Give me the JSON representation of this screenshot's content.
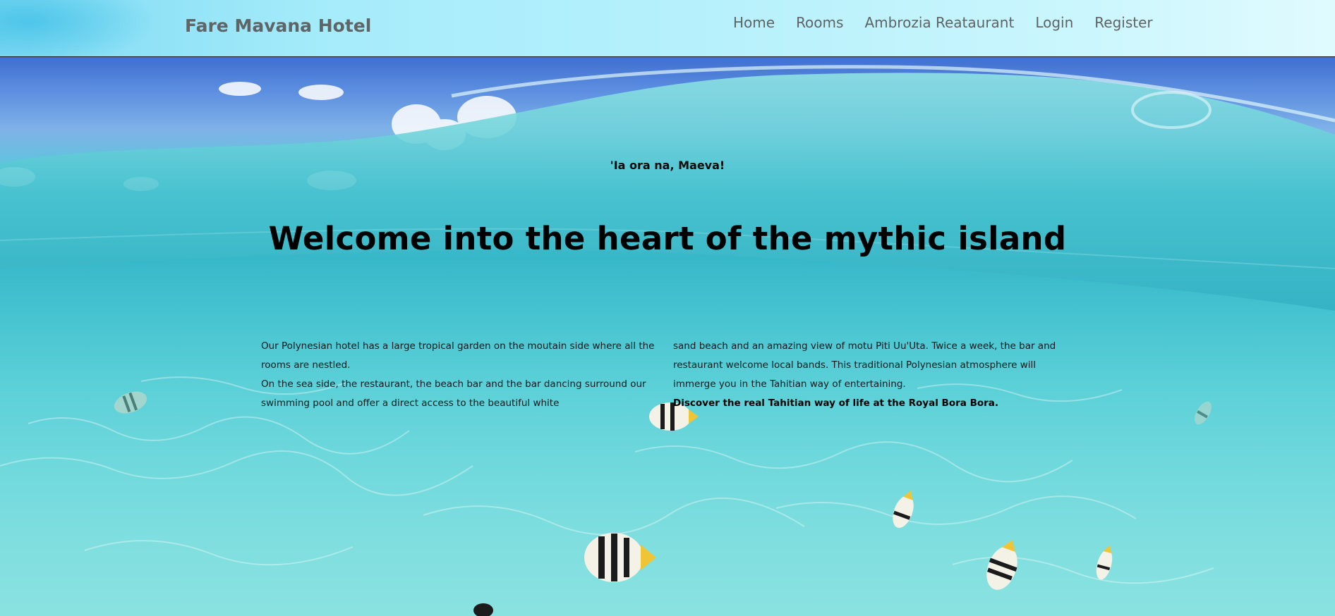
{
  "brand": {
    "name": "Fare Mavana Hotel"
  },
  "nav": {
    "items": [
      {
        "label": "Home"
      },
      {
        "label": "Rooms"
      },
      {
        "label": "Ambrozia Reataurant"
      },
      {
        "label": "Login"
      },
      {
        "label": "Register"
      }
    ]
  },
  "hero": {
    "tagline": "'Ia ora na, Maeva!",
    "headline": "Welcome into the heart of the mythic island",
    "left_column": {
      "para1": "Our Polynesian hotel has a large tropical garden on the moutain side where all the rooms are nestled.",
      "para2": "On the sea side, the restaurant, the beach bar and the bar dancing surround our swimming pool and offer a direct access to the beautiful white"
    },
    "right_column": {
      "para1": "sand beach and an amazing view of motu Piti Uu'Uta. Twice a week, the bar and restaurant welcome local bands. This traditional Polynesian atmosphere will immerge you in the Tahitian way of entertaining.",
      "emphasis": "Discover the real Tahitian way of life at the Royal Bora Bora."
    }
  },
  "colors": {
    "nav_text": "#5e6466",
    "brand_text": "#5f6466",
    "sky": "#3f6fd0",
    "water": "#3dbfcf",
    "shallow": "#8ae2e0"
  }
}
